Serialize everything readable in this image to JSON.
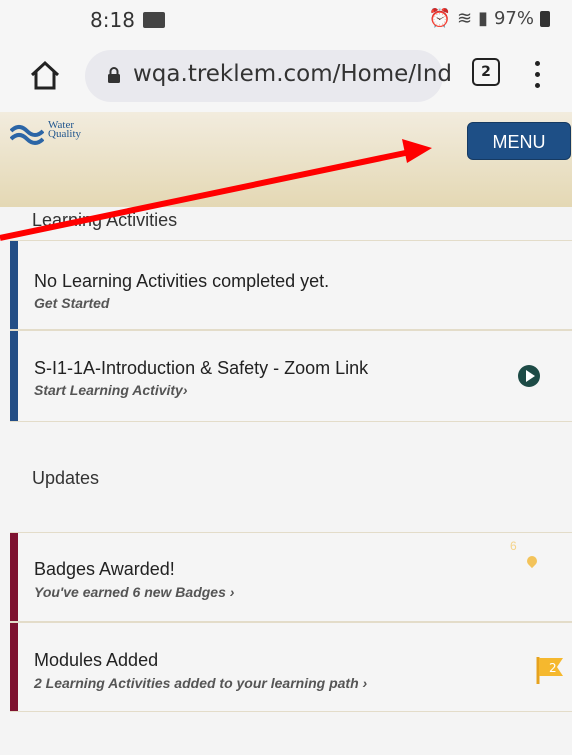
{
  "status": {
    "time": "8:18",
    "battery": "97%"
  },
  "browser": {
    "url": "wqa.treklem.com/Home/Ind",
    "tab_count": "2"
  },
  "header": {
    "logo_line1": "Water",
    "logo_line2": "Quality",
    "menu_label": "MENU"
  },
  "learning": {
    "section_title": "Learning Activities",
    "items": [
      {
        "title": "No Learning Activities completed yet.",
        "subtitle": "Get Started"
      },
      {
        "title": "S-I1-1A-Introduction & Safety - Zoom Link",
        "subtitle": "Start Learning Activity›"
      }
    ]
  },
  "updates": {
    "section_title": "Updates",
    "items": [
      {
        "title": "Badges Awarded!",
        "subtitle": "You've earned 6 new Badges ›",
        "badge_count": "6"
      },
      {
        "title": "Modules Added",
        "subtitle": "2 Learning Activities added to your learning path ›",
        "flag_count": "2"
      }
    ]
  },
  "colors": {
    "accent_blue": "#1e4f86",
    "learning_bar": "#234e86",
    "updates_bar": "#7e1230",
    "annotation_arrow": "#ff0000"
  }
}
